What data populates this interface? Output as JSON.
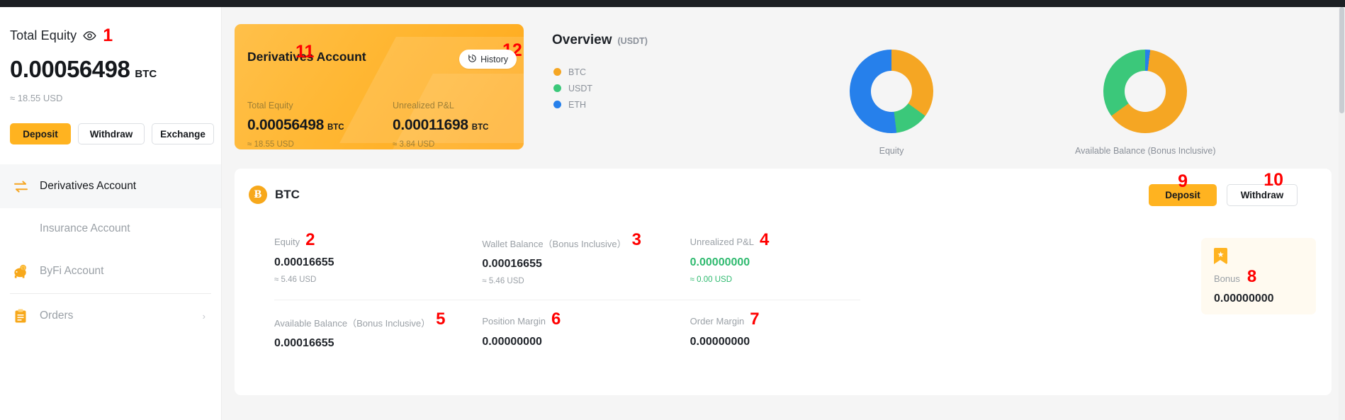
{
  "sidebar": {
    "total_equity_label": "Total Equity",
    "marker_1": "1",
    "amount": "0.00056498",
    "currency": "BTC",
    "usd_approx": "≈ 18.55 USD",
    "buttons": [
      {
        "label": "Deposit"
      },
      {
        "label": "Withdraw"
      },
      {
        "label": "Exchange"
      }
    ],
    "nav": [
      {
        "label": "Derivatives Account",
        "icon": "exchange-arrows-icon",
        "active": true
      },
      {
        "label": "Insurance Account",
        "icon": "none",
        "active": false
      },
      {
        "label": "ByFi Account",
        "icon": "piggy-bank-icon",
        "active": false
      },
      {
        "label": "Orders",
        "icon": "clipboard-icon",
        "active": false,
        "chevron": "›"
      }
    ]
  },
  "derivatives_card": {
    "title": "Derivatives Account",
    "marker_11": "11",
    "marker_12": "12",
    "history_label": "History",
    "history_icon": "clock-history-icon",
    "stats": [
      {
        "label": "Total Equity",
        "value": "0.00056498",
        "unit": "BTC",
        "usd": "≈ 18.55 USD"
      },
      {
        "label": "Unrealized P&L",
        "value": "0.00011698",
        "unit": "BTC",
        "usd": "≈ 3.84 USD"
      }
    ]
  },
  "overview": {
    "title": "Overview",
    "subtitle": "(USDT)",
    "legend": [
      {
        "label": "BTC",
        "color": "#f5a623"
      },
      {
        "label": "USDT",
        "color": "#3bc87a"
      },
      {
        "label": "ETH",
        "color": "#2680eb"
      }
    ],
    "charts": [
      {
        "caption": "Equity"
      },
      {
        "caption": "Available Balance (Bonus Inclusive)"
      }
    ]
  },
  "chart_data": [
    {
      "type": "pie",
      "title": "Equity",
      "categories": [
        "BTC",
        "USDT",
        "ETH"
      ],
      "values": [
        35,
        13,
        52
      ],
      "colors": [
        "#f5a623",
        "#3bc87a",
        "#2680eb"
      ],
      "legend": "left",
      "unit": "percent"
    },
    {
      "type": "pie",
      "title": "Available Balance (Bonus Inclusive)",
      "categories": [
        "BTC",
        "USDT",
        "ETH"
      ],
      "values": [
        63,
        35,
        2
      ],
      "colors": [
        "#f5a623",
        "#3bc87a",
        "#2680eb"
      ],
      "legend": "left",
      "unit": "percent"
    }
  ],
  "panel": {
    "coin_symbol": "Ƀ",
    "coin_name": "BTC",
    "deposit_label": "Deposit",
    "withdraw_label": "Withdraw",
    "marker_9": "9",
    "marker_10": "10",
    "metrics": [
      {
        "label": "Equity",
        "marker": "2",
        "value": "0.00016655",
        "usd": "≈ 5.46 USD",
        "green": false
      },
      {
        "label": "Wallet Balance（Bonus Inclusive）",
        "marker": "3",
        "value": "0.00016655",
        "usd": "≈ 5.46 USD",
        "green": false
      },
      {
        "label": "Unrealized P&L",
        "marker": "4",
        "value": "0.00000000",
        "usd": "≈ 0.00 USD",
        "green": true
      },
      {
        "label": "Available Balance（Bonus Inclusive）",
        "marker": "5",
        "value": "0.00016655",
        "usd": "",
        "green": false
      },
      {
        "label": "Position Margin",
        "marker": "6",
        "value": "0.00000000",
        "usd": "",
        "green": false
      },
      {
        "label": "Order Margin",
        "marker": "7",
        "value": "0.00000000",
        "usd": "",
        "green": false
      }
    ],
    "bonus": {
      "icon": "bonus-star-bookmark-icon",
      "label": "Bonus",
      "marker": "8",
      "value": "0.00000000"
    }
  }
}
